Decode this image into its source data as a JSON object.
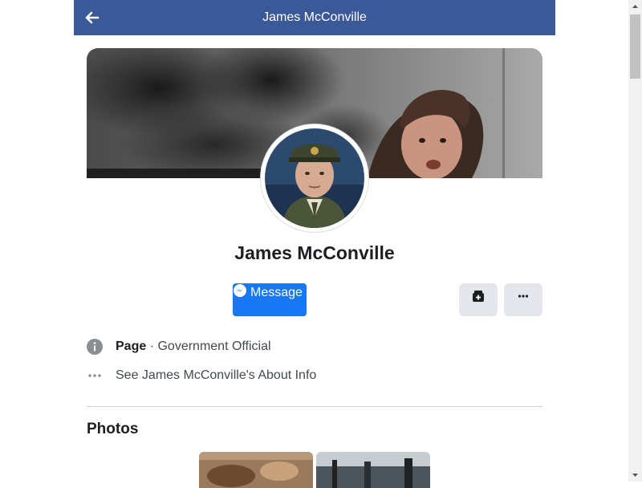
{
  "header": {
    "title": "James McConville",
    "back_icon": "back-arrow-icon"
  },
  "profile": {
    "name": "James McConville"
  },
  "actions": {
    "message_label": "Message",
    "message_icon": "messenger-icon",
    "save_icon": "save-icon",
    "more_icon": "more-dots-icon",
    "accent_color": "#1877f2"
  },
  "info": {
    "page_label": "Page",
    "separator": " · ",
    "category": "Government Official",
    "about_text": "See James McConville's About Info",
    "info_icon": "info-icon",
    "about_icon": "dots-icon"
  },
  "photos": {
    "title": "Photos"
  },
  "colors": {
    "header_bg": "#3b5998",
    "text_dark": "#1c1e21",
    "text_muted": "#444950"
  }
}
